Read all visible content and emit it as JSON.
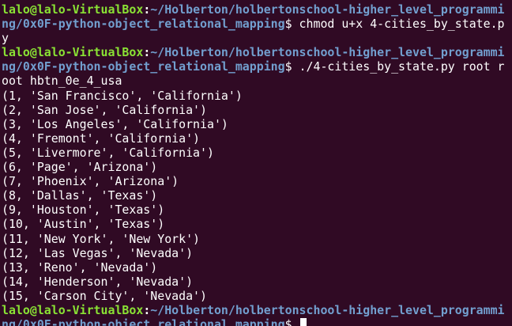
{
  "prompt": {
    "user_host": "lalo@lalo-VirtualBox",
    "colon": ":",
    "dollar": "$"
  },
  "lines": {
    "l1_path": "~/Holberton/holbertonschool-higher_level_programmi",
    "l1_dollar": "$",
    "l1_cmd": " chmod u+x 4-cities_by_state.p",
    "l2_cont": "y",
    "l3_path": "~/Holberton/holbertonschool-higher_level_programmi",
    "l4_path": "ng/0x0F-python-object_relational_mapping",
    "l4_dollar": "$",
    "l4_cmd": " ./4-cities_by_state.py root r",
    "l5_cont": "oot hbtn_0e_4_usa",
    "l20_path": "~/Holberton/holbertonschool-higher_level_programmi",
    "l21_path": "ng/0x0F-python-object_relational_mapping",
    "l21_dollar": "$",
    "l21_cmd": " "
  },
  "l1_part0": "ng/0x0F-python-object_relational_mapping",
  "output": [
    "(1, 'San Francisco', 'California')",
    "(2, 'San Jose', 'California')",
    "(3, 'Los Angeles', 'California')",
    "(4, 'Fremont', 'California')",
    "(5, 'Livermore', 'California')",
    "(6, 'Page', 'Arizona')",
    "(7, 'Phoenix', 'Arizona')",
    "(8, 'Dallas', 'Texas')",
    "(9, 'Houston', 'Texas')",
    "(10, 'Austin', 'Texas')",
    "(11, 'New York', 'New York')",
    "(12, 'Las Vegas', 'Nevada')",
    "(13, 'Reno', 'Nevada')",
    "(14, 'Henderson', 'Nevada')",
    "(15, 'Carson City', 'Nevada')"
  ],
  "colors": {
    "background": "#300a24",
    "prompt_user": "#8ae234",
    "prompt_path": "#729fcf",
    "text": "#ffffff"
  }
}
